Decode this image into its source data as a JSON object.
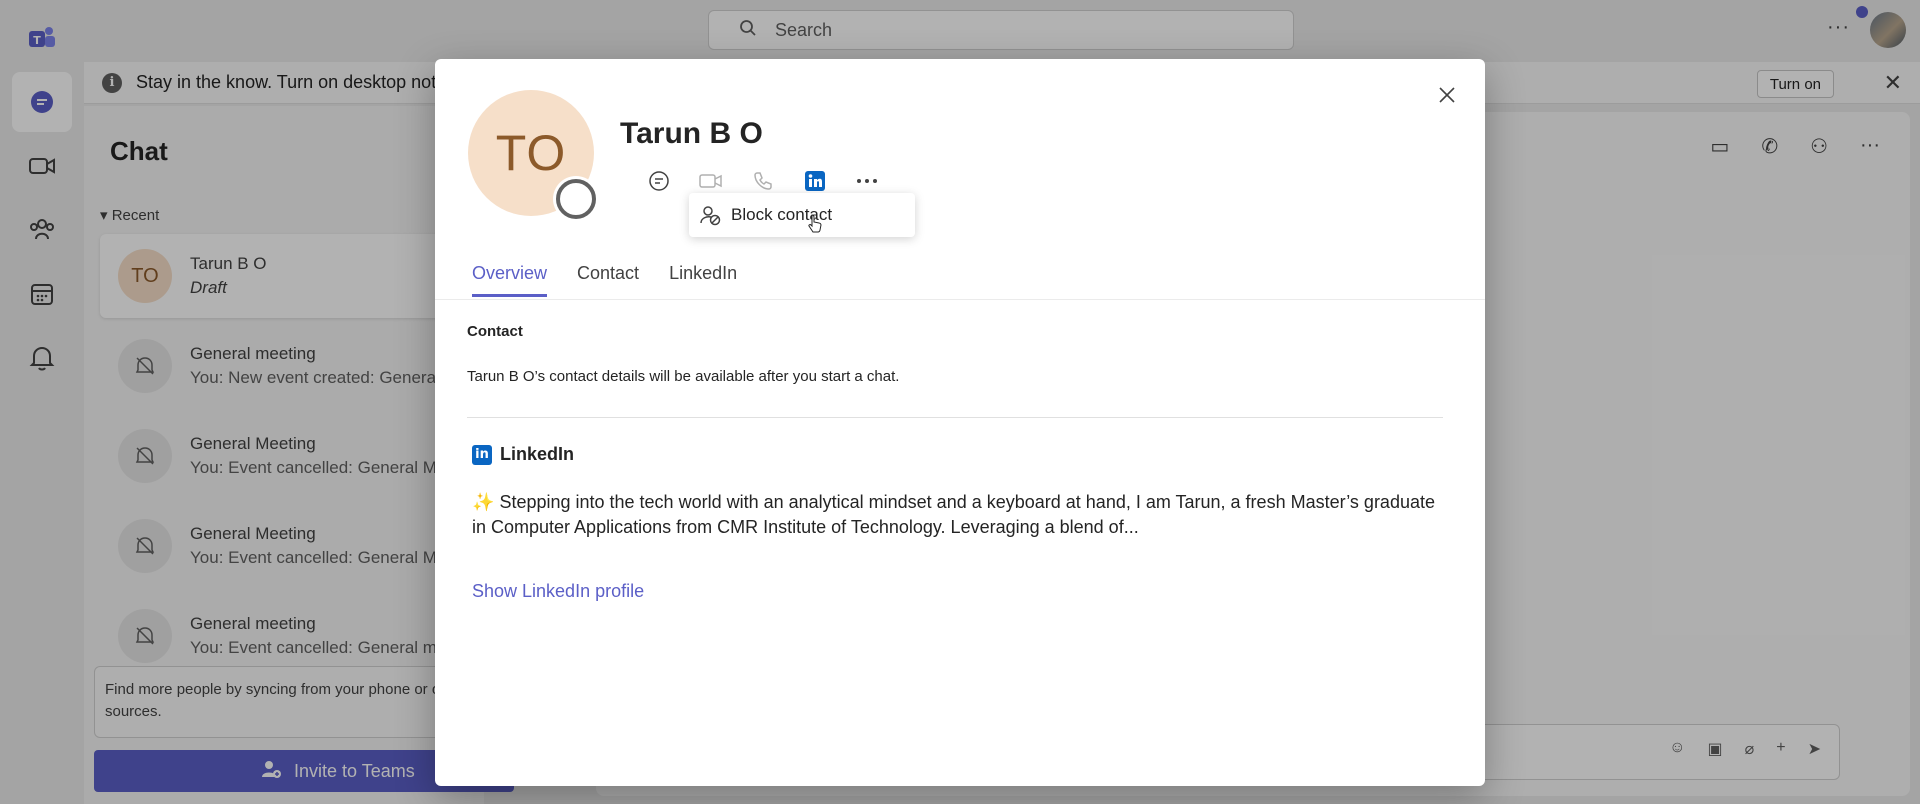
{
  "app": {
    "search_placeholder": "Search",
    "notification": {
      "text": "Stay in the know. Turn on desktop noti",
      "turn_on_label": "Turn on"
    },
    "chat_pane": {
      "title": "Chat",
      "section_label": "Recent",
      "items": [
        {
          "initials": "TO",
          "title": "Tarun B O",
          "subtitle": "Draft"
        },
        {
          "title": "General meeting",
          "subtitle": "You: New event created: Genera"
        },
        {
          "title": "General Meeting",
          "subtitle": "You: Event cancelled: General M"
        },
        {
          "title": "General Meeting",
          "subtitle": "You: Event cancelled: General M"
        },
        {
          "title": "General meeting",
          "subtitle": "You: Event cancelled: General m"
        }
      ],
      "sync_text": "Find more people by syncing from your phone or other sources.",
      "invite_label": "Invite to Teams"
    }
  },
  "profile": {
    "initials": "TO",
    "name": "Tarun B O",
    "menu_item": "Block contact",
    "tabs": [
      "Overview",
      "Contact",
      "LinkedIn"
    ],
    "active_tab": "Overview",
    "contact_section_title": "Contact",
    "contact_text": "Tarun B O’s contact details will be available after you start a chat.",
    "linkedin_title": "LinkedIn",
    "linkedin_badge": "in",
    "bio_emoji": "✨",
    "bio": "Stepping into the tech world with an analytical mindset and a keyboard at hand, I am Tarun, a fresh Master’s graduate in Computer Applications from CMR Institute of Technology. Leveraging a blend of...",
    "show_profile_link": "Show LinkedIn profile"
  },
  "colors": {
    "accent": "#5b5fc7",
    "linkedin": "#0a66c2",
    "avatar_bg": "#f6dfc9",
    "avatar_text": "#8c5a2a"
  }
}
